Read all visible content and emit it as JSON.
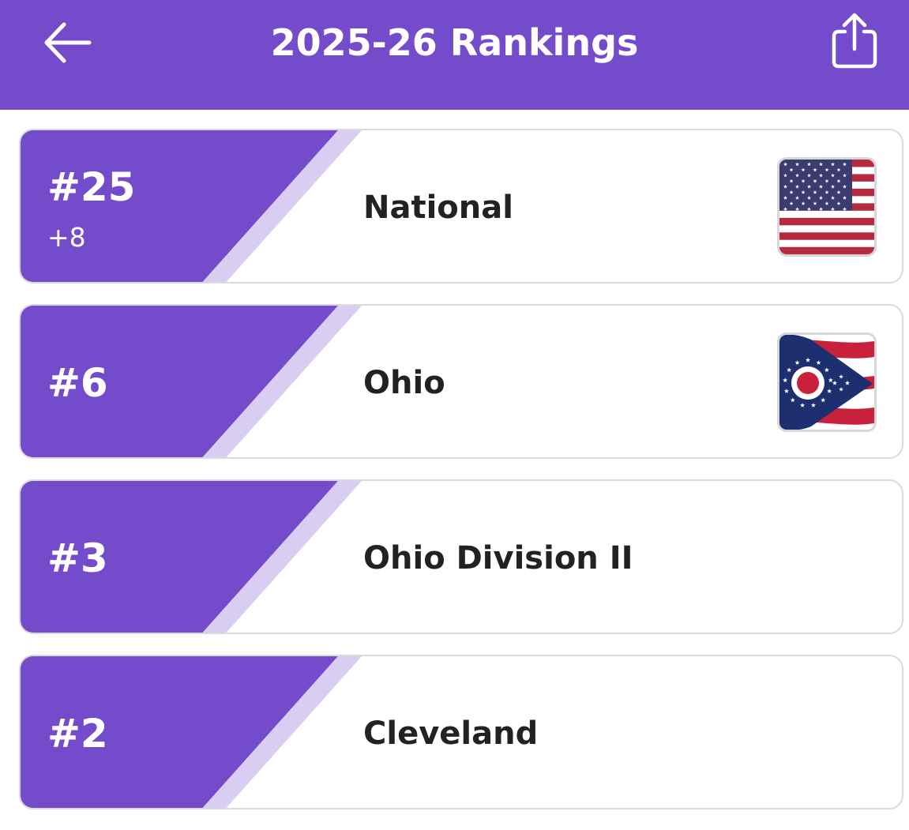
{
  "header": {
    "title": "2025-26 Rankings",
    "back_icon": "back-arrow-icon",
    "share_icon": "share-icon"
  },
  "colors": {
    "accent": "#744bcb",
    "accent_light": "#d9cdf1",
    "text": "#222222",
    "card_border": "#dadadd"
  },
  "rankings": [
    {
      "rank": "#25",
      "change": "+8",
      "label": "National",
      "flag_icon": "us-flag-icon"
    },
    {
      "rank": "#6",
      "label": "Ohio",
      "flag_icon": "ohio-flag-icon"
    },
    {
      "rank": "#3",
      "label": "Ohio Division II"
    },
    {
      "rank": "#2",
      "label": "Cleveland"
    }
  ]
}
